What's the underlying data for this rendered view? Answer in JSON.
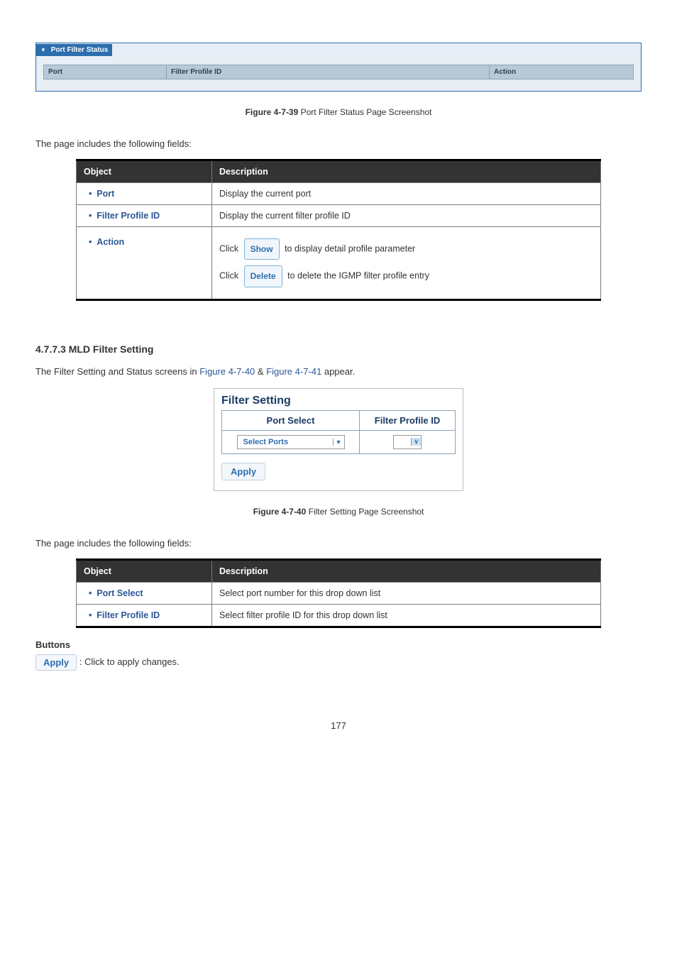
{
  "panel": {
    "title": "Port Filter Status",
    "columns": {
      "port": "Port",
      "fpid": "Filter Profile ID",
      "action": "Action"
    }
  },
  "caption1": {
    "figure": "Figure 4-7-39",
    "text": " Port Filter Status Page Screenshot"
  },
  "intro1": "The page includes the following fields:",
  "table1": {
    "head": {
      "object": "Object",
      "description": "Description"
    },
    "rows": {
      "port": {
        "name": "Port",
        "desc": "Display the current port"
      },
      "fpid": {
        "name": "Filter Profile ID",
        "desc": "Display the current filter profile ID"
      },
      "action": {
        "name": "Action",
        "click": "Click",
        "show": "Show",
        "show_text": " to display detail profile parameter",
        "delete": "Delete",
        "delete_text": " to delete the IGMP filter profile entry"
      }
    }
  },
  "section": {
    "heading": "4.7.7.3 MLD Filter Setting",
    "text_a": "The Filter Setting and Status screens in ",
    "link1": "Figure 4-7-40",
    "amp": " & ",
    "link2": "Figure 4-7-41",
    "text_b": " appear."
  },
  "filter_widget": {
    "title": "Filter Setting",
    "col1": "Port Select",
    "col2": "Filter Profile ID",
    "select_ports": "Select Ports",
    "apply": "Apply"
  },
  "caption2": {
    "figure": "Figure 4-7-40",
    "text": " Filter Setting Page Screenshot"
  },
  "intro2": "The page includes the following fields:",
  "table2": {
    "head": {
      "object": "Object",
      "description": "Description"
    },
    "rows": {
      "ps": {
        "name": "Port Select",
        "desc": "Select port number for this drop down list"
      },
      "fpid": {
        "name": "Filter Profile ID",
        "desc": "Select filter profile ID for this drop down list"
      }
    }
  },
  "buttons": {
    "heading": "Buttons",
    "apply": "Apply",
    "apply_text": ": Click to apply changes."
  },
  "page_number": "177"
}
